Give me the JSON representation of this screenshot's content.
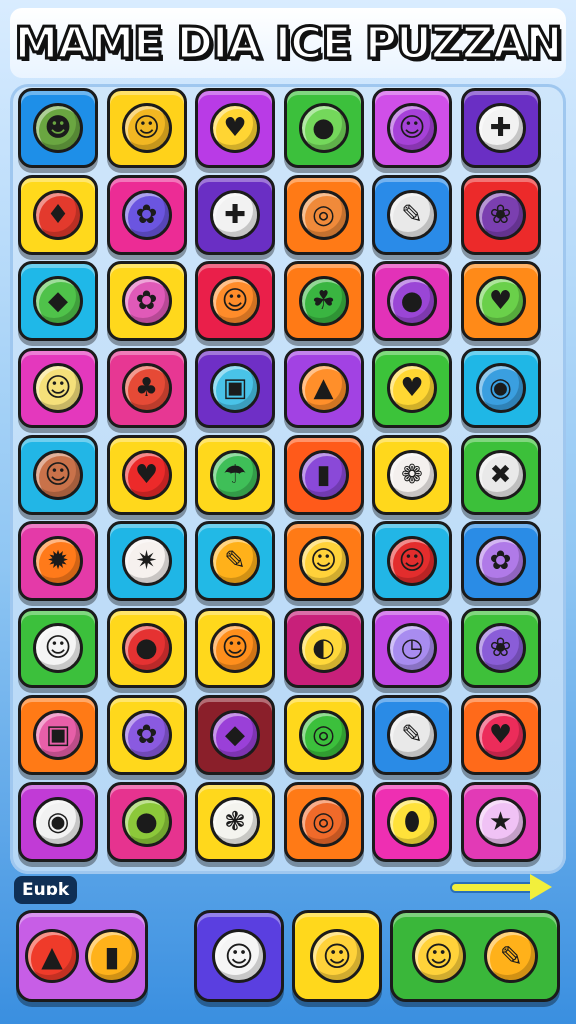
{
  "title": "MAME DIA ICE PUZZAN",
  "footer": {
    "label": "Euɒk"
  },
  "tiles": [
    {
      "icon": "turtle-icon",
      "glyph": "☻",
      "bg": "#1e8fe8",
      "fg": "#6aa641"
    },
    {
      "icon": "sun-face-icon",
      "glyph": "☺",
      "bg": "#ffd21a",
      "fg": "#f2b722"
    },
    {
      "icon": "heart-icon",
      "glyph": "♥",
      "bg": "#b93be6",
      "fg": "#ffd533"
    },
    {
      "icon": "lime-icon",
      "glyph": "●",
      "bg": "#3cc03c",
      "fg": "#74d85b"
    },
    {
      "icon": "plum-icon",
      "glyph": "☺",
      "bg": "#d04fe8",
      "fg": "#a641d8"
    },
    {
      "icon": "gamepad-icon",
      "glyph": "✚",
      "bg": "#6a2fc4",
      "fg": "#f2f2f2"
    },
    {
      "icon": "strawberry-icon",
      "glyph": "♦",
      "bg": "#ffd91c",
      "fg": "#e33a2d"
    },
    {
      "icon": "berries-icon",
      "glyph": "✿",
      "bg": "#ec2c95",
      "fg": "#6b55e0"
    },
    {
      "icon": "gamepad-icon",
      "glyph": "✚",
      "bg": "#6a2fc4",
      "fg": "#f2f2f2"
    },
    {
      "icon": "swirl-icon",
      "glyph": "◎",
      "bg": "#ff7a16",
      "fg": "#f08a3a"
    },
    {
      "icon": "paint-roller-icon",
      "glyph": "✎",
      "bg": "#2a8be8",
      "fg": "#e9e9e9"
    },
    {
      "icon": "grapes-icon",
      "glyph": "❀",
      "bg": "#ec2a2a",
      "fg": "#7b3fb0"
    },
    {
      "icon": "leaf-icon",
      "glyph": "◆",
      "bg": "#1fb8e8",
      "fg": "#4fc24a"
    },
    {
      "icon": "flower-icon",
      "glyph": "✿",
      "bg": "#ffd81c",
      "fg": "#e05ab8"
    },
    {
      "icon": "tomato-icon",
      "glyph": "☺",
      "bg": "#ea1f4a",
      "fg": "#ff8c2a"
    },
    {
      "icon": "pepper-icon",
      "glyph": "☘",
      "bg": "#ff7a16",
      "fg": "#3ab541"
    },
    {
      "icon": "plum-icon",
      "glyph": "●",
      "bg": "#e232b8",
      "fg": "#9a46d6"
    },
    {
      "icon": "lime-icon",
      "glyph": "♥",
      "bg": "#ff8a18",
      "fg": "#6ad04a"
    },
    {
      "icon": "chick-face-icon",
      "glyph": "☺",
      "bg": "#e438bd",
      "fg": "#f5e07a"
    },
    {
      "icon": "strawberry-icon",
      "glyph": "♣",
      "bg": "#e73793",
      "fg": "#e64a36"
    },
    {
      "icon": "radio-icon",
      "glyph": "▣",
      "bg": "#6f2fc6",
      "fg": "#49c3e8"
    },
    {
      "icon": "cone-icon",
      "glyph": "▲",
      "bg": "#a242e3",
      "fg": "#ff8f2a"
    },
    {
      "icon": "heart-icon",
      "glyph": "♥",
      "bg": "#3cc33a",
      "fg": "#ffd733"
    },
    {
      "icon": "globe-icon",
      "glyph": "◉",
      "bg": "#1fb7e6",
      "fg": "#3a9fe0"
    },
    {
      "icon": "acorn-icon",
      "glyph": "☺",
      "bg": "#22b6e6",
      "fg": "#c9724a"
    },
    {
      "icon": "heart-icon",
      "glyph": "♥",
      "bg": "#ffd81c",
      "fg": "#ec2a2a"
    },
    {
      "icon": "umbrella-icon",
      "glyph": "☂",
      "bg": "#ffd81c",
      "fg": "#3fbf58"
    },
    {
      "icon": "popsicle-icon",
      "glyph": "▮",
      "bg": "#ff5a1a",
      "fg": "#8a49d8"
    },
    {
      "icon": "ice-cream-icon",
      "glyph": "❁",
      "bg": "#ffd81c",
      "fg": "#f4f0ee"
    },
    {
      "icon": "crossed-tools-icon",
      "glyph": "✖",
      "bg": "#3cc03a",
      "fg": "#e9e9e9"
    },
    {
      "icon": "pineapple-icon",
      "glyph": "✹",
      "bg": "#e43aa8",
      "fg": "#ff7a1a"
    },
    {
      "icon": "pinwheel-icon",
      "glyph": "✷",
      "bg": "#1fb6e6",
      "fg": "#f6f1ee"
    },
    {
      "icon": "pencil-icon",
      "glyph": "✎",
      "bg": "#22b9e6",
      "fg": "#ffb11a"
    },
    {
      "icon": "orange-face-icon",
      "glyph": "☺",
      "bg": "#ff7a16",
      "fg": "#ffd23a"
    },
    {
      "icon": "apple-face-icon",
      "glyph": "☺",
      "bg": "#22b6e6",
      "fg": "#e32d2d"
    },
    {
      "icon": "blob-icon",
      "glyph": "✿",
      "bg": "#2a8ce6",
      "fg": "#b07ae8"
    },
    {
      "icon": "onion-face-icon",
      "glyph": "☺",
      "bg": "#3cc03c",
      "fg": "#f4f4f4"
    },
    {
      "icon": "apple-icon",
      "glyph": "●",
      "bg": "#ffd81c",
      "fg": "#e53232"
    },
    {
      "icon": "orange-face-icon",
      "glyph": "☺",
      "bg": "#ffd81c",
      "fg": "#ff8f1c"
    },
    {
      "icon": "taco-icon",
      "glyph": "◐",
      "bg": "#c8207a",
      "fg": "#ffd83a"
    },
    {
      "icon": "clock-icon",
      "glyph": "◷",
      "bg": "#c045e3",
      "fg": "#a88cf0"
    },
    {
      "icon": "melon-icon",
      "glyph": "❀",
      "bg": "#3ec03a",
      "fg": "#8a5dd8"
    },
    {
      "icon": "radio-icon",
      "glyph": "▣",
      "bg": "#ff7a16",
      "fg": "#e75fa8"
    },
    {
      "icon": "flower-icon",
      "glyph": "✿",
      "bg": "#ffd81c",
      "fg": "#8a5ae0"
    },
    {
      "icon": "kite-icon",
      "glyph": "◆",
      "bg": "#8a1f2a",
      "fg": "#9a40d8"
    },
    {
      "icon": "lime-swirl-icon",
      "glyph": "◎",
      "bg": "#ffd81c",
      "fg": "#3cc03c"
    },
    {
      "icon": "paint-roller-icon",
      "glyph": "✎",
      "bg": "#2a8be6",
      "fg": "#e9e9e9"
    },
    {
      "icon": "apple-icon",
      "glyph": "♥",
      "bg": "#ff6a1a",
      "fg": "#ec2c5a"
    },
    {
      "icon": "pin-icon",
      "glyph": "◉",
      "bg": "#c13bd6",
      "fg": "#f2f2f2"
    },
    {
      "icon": "pear-icon",
      "glyph": "●",
      "bg": "#e6338f",
      "fg": "#8cc83a"
    },
    {
      "icon": "rice-ball-icon",
      "glyph": "❃",
      "bg": "#ffd81c",
      "fg": "#f4f4ef"
    },
    {
      "icon": "swirl-icon",
      "glyph": "◎",
      "bg": "#ff7a16",
      "fg": "#f06a2a"
    },
    {
      "icon": "pickle-icon",
      "glyph": "⬮",
      "bg": "#ee2fb2",
      "fg": "#ffe23a"
    },
    {
      "icon": "star-icon",
      "glyph": "★",
      "bg": "#e23ab6",
      "fg": "#f0c2f5"
    }
  ],
  "buttons": [
    {
      "name": "tools-button",
      "bg": "#c75ee6",
      "icons": [
        {
          "name": "cone-icon",
          "glyph": "▲",
          "fg": "#ef3b2a"
        },
        {
          "name": "bottle-icon",
          "glyph": "▮",
          "fg": "#ffb21a"
        }
      ]
    },
    {
      "name": "cat-button",
      "bg": "#5a3fe0",
      "icons": [
        {
          "name": "cat-face-icon",
          "glyph": "☺",
          "fg": "#f5f5f5"
        }
      ]
    },
    {
      "name": "fox-button",
      "bg": "#ffd81c",
      "icons": [
        {
          "name": "fox-face-icon",
          "glyph": "☺",
          "fg": "#ffd23a"
        }
      ]
    },
    {
      "name": "pencil-button",
      "bg": "#3ab73a",
      "icons": [
        {
          "name": "face-icon",
          "glyph": "☺",
          "fg": "#ffd23a"
        },
        {
          "name": "pencil-icon",
          "glyph": "✎",
          "fg": "#ffb11a"
        }
      ]
    }
  ]
}
